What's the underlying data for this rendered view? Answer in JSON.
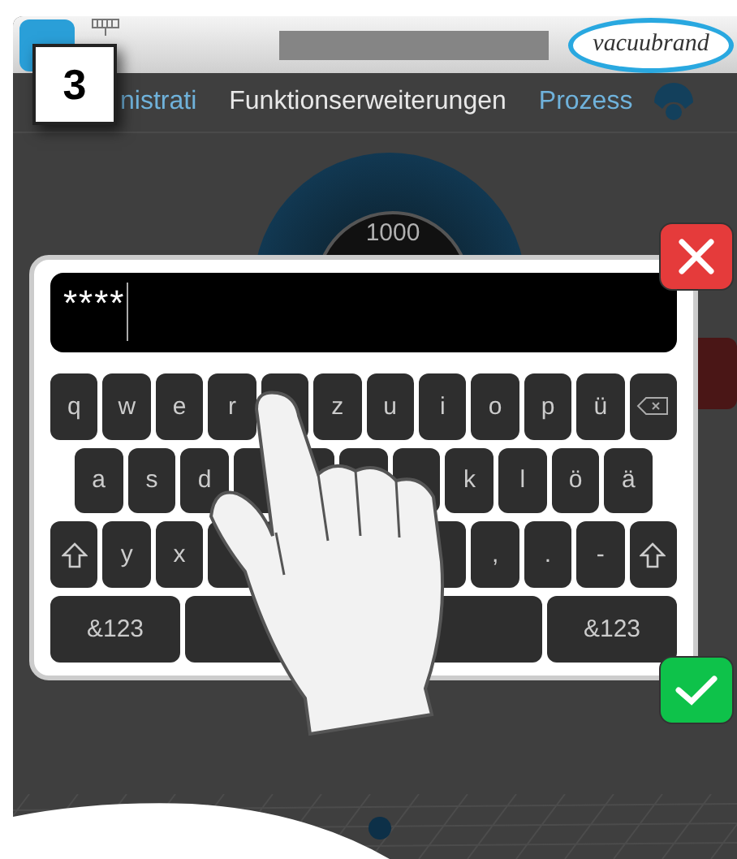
{
  "step_badge": "3",
  "header": {
    "logo": "vacuubrand"
  },
  "tabs": [
    {
      "label": "nistrati",
      "selected": false
    },
    {
      "label": "Funktionserweiterungen",
      "selected": true
    },
    {
      "label": "Prozess",
      "selected": false
    }
  ],
  "gauge": {
    "value": "1000"
  },
  "keyboard": {
    "input": {
      "value": "****"
    },
    "rows": [
      {
        "keys": [
          {
            "kind": "key",
            "label": "q"
          },
          {
            "kind": "key",
            "label": "w"
          },
          {
            "kind": "key",
            "label": "e"
          },
          {
            "kind": "key",
            "label": "r"
          },
          {
            "kind": "key"
          },
          {
            "kind": "key",
            "label": "z"
          },
          {
            "kind": "key",
            "label": "u"
          },
          {
            "kind": "key",
            "label": "i"
          },
          {
            "kind": "key",
            "label": "o"
          },
          {
            "kind": "key",
            "label": "p"
          },
          {
            "kind": "key",
            "label": "ü"
          },
          {
            "kind": "backspace"
          }
        ]
      },
      {
        "keys": [
          {
            "kind": "key",
            "label": "a"
          },
          {
            "kind": "key",
            "label": "s"
          },
          {
            "kind": "key",
            "label": "d"
          },
          {
            "kind": "key"
          },
          {
            "kind": "key"
          },
          {
            "kind": "key"
          },
          {
            "kind": "key"
          },
          {
            "kind": "key",
            "label": "k"
          },
          {
            "kind": "key",
            "label": "l"
          },
          {
            "kind": "key",
            "label": "ö"
          },
          {
            "kind": "key",
            "label": "ä"
          }
        ]
      },
      {
        "keys": [
          {
            "kind": "shift"
          },
          {
            "kind": "key",
            "label": "y"
          },
          {
            "kind": "key",
            "label": "x"
          },
          {
            "kind": "key"
          },
          {
            "kind": "key"
          },
          {
            "kind": "key"
          },
          {
            "kind": "key"
          },
          {
            "kind": "key"
          },
          {
            "kind": "key",
            "label": ","
          },
          {
            "kind": "key",
            "label": "."
          },
          {
            "kind": "key",
            "label": "-"
          },
          {
            "kind": "shift"
          }
        ]
      },
      {
        "keys": [
          {
            "kind": "wide",
            "label": "&123"
          },
          {
            "kind": "space"
          },
          {
            "kind": "wide",
            "label": "&123"
          }
        ]
      }
    ]
  }
}
